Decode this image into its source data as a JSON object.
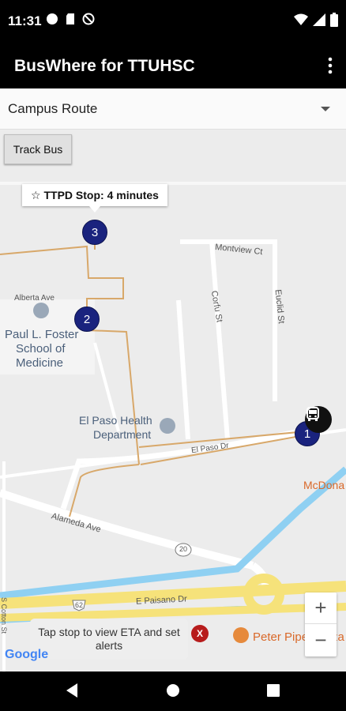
{
  "status_bar": {
    "time": "11:31"
  },
  "app_bar": {
    "title": "BusWhere for TTUHSC"
  },
  "route_select": {
    "selected": "Campus Route"
  },
  "track_bus_label": "Track Bus",
  "info_window": {
    "text": "☆ TTPD Stop: 4 minutes"
  },
  "stops": [
    {
      "number": "3"
    },
    {
      "number": "2"
    },
    {
      "number": "1"
    }
  ],
  "map_labels": {
    "montview": "Montview Ct",
    "corfu": "Corfu St",
    "euclid": "Euclid St",
    "alberta": "Alberta Ave",
    "paul_foster_1": "Paul L. Foster",
    "paul_foster_2": "School of",
    "paul_foster_3": "Medicine",
    "health_dept_1": "El Paso Health",
    "health_dept_2": "Department",
    "el_paso_dr": "El Paso Dr",
    "mcdonalds": "McDona",
    "alameda": "Alameda Ave",
    "route_20": "20",
    "route_62": "62",
    "paisano": "E Paisano Dr",
    "peter_piper": "Peter Piper Pizza",
    "side_street": "S Cotton St",
    "google": "Google"
  },
  "eta_toast": {
    "text": "Tap stop to view ETA and set alerts",
    "close": "X"
  },
  "zoom": {
    "in": "+",
    "out": "−"
  },
  "colors": {
    "map_bg": "#ececec",
    "stop_marker": "#1a237e",
    "route_line": "#d8a86a",
    "water": "#8fd0f2",
    "highway": "#f6e27a",
    "close_button": "#b71c1c"
  },
  "icons": {
    "wifi": "wifi-icon",
    "signal": "signal-icon",
    "battery": "battery-icon",
    "overflow": "more-vert-icon",
    "bus": "bus-icon",
    "back": "back-icon",
    "home": "home-icon",
    "recents": "recents-icon"
  }
}
